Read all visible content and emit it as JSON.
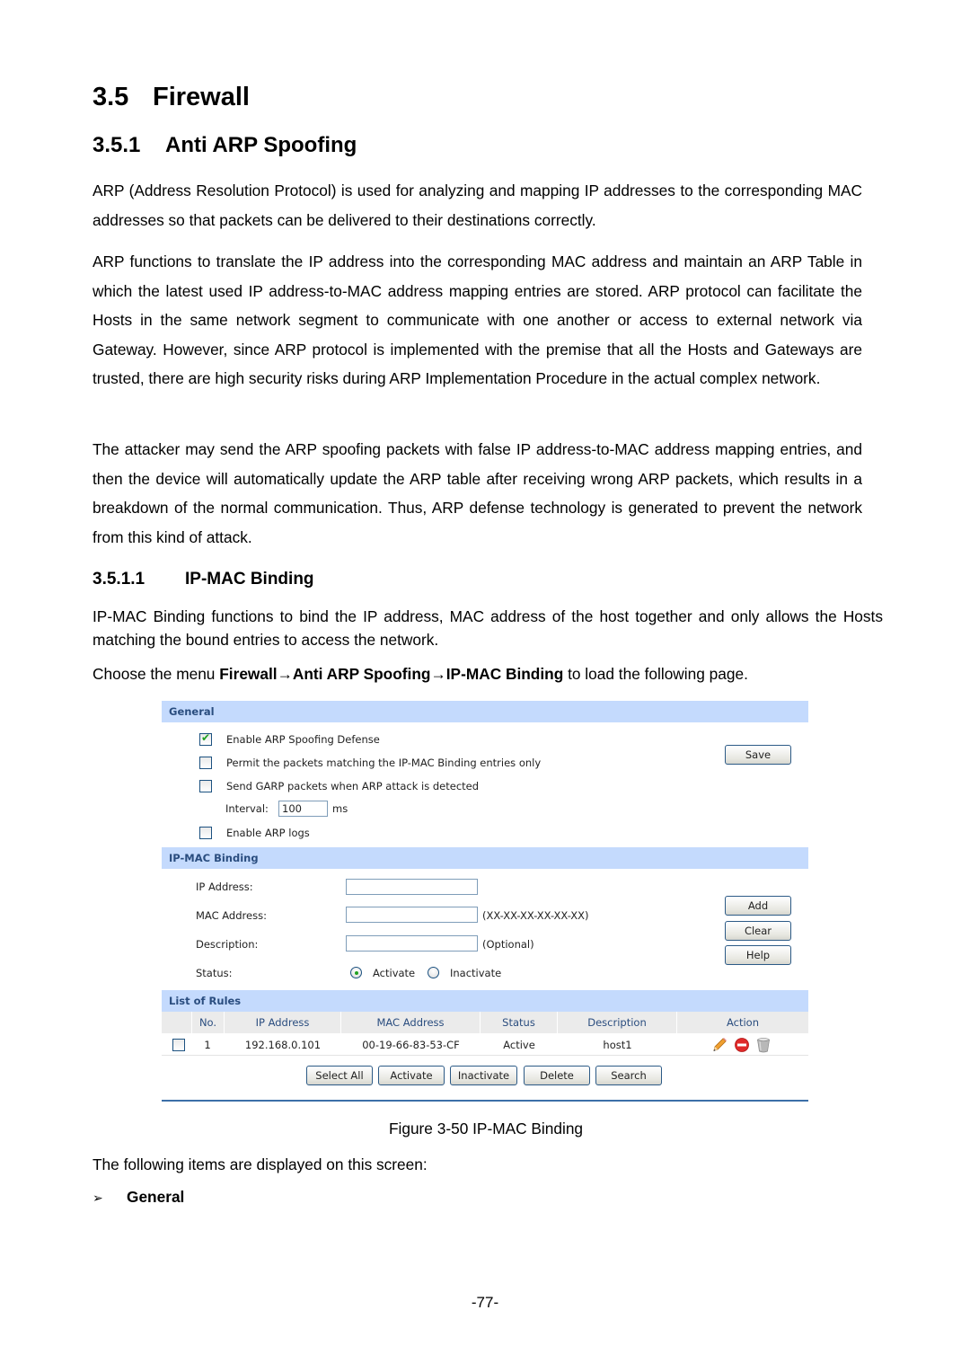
{
  "doc": {
    "h1": {
      "number": "3.5",
      "title": "Firewall"
    },
    "h2": {
      "number": "3.5.1",
      "title": "Anti ARP Spoofing"
    },
    "para1": "ARP (Address Resolution Protocol) is used for analyzing and mapping IP addresses to the corresponding MAC addresses so that packets can be delivered to their destinations correctly.",
    "para2": "ARP functions to translate the IP address into the corresponding MAC address and maintain an ARP Table in which the latest used IP address-to-MAC address mapping entries are stored. ARP protocol can facilitate the Hosts in the same network segment to communicate with one another or access to external network via Gateway. However, since ARP protocol is implemented with the premise that all the Hosts and Gateways are trusted, there are high security risks during ARP Implementation Procedure in the actual complex network.",
    "para3": "The attacker may send the ARP spoofing packets with false IP address-to-MAC address mapping entries, and then the device will automatically update the ARP table after receiving wrong ARP packets, which results in a breakdown of the normal communication. Thus, ARP defense technology is generated to prevent the network from this kind of attack.",
    "h3": {
      "number": "3.5.1.1",
      "title": "IP-MAC Binding"
    },
    "para4": "IP-MAC Binding functions to bind the IP address, MAC address of the host together and only allows the Hosts matching the bound entries to access the network.",
    "para5": {
      "prefix": "Choose the menu ",
      "menu_path": "Firewall→Anti ARP Spoofing→IP-MAC Binding",
      "suffix": " to load the following page."
    },
    "caption": "Figure 3-50 IP-MAC Binding",
    "para6": "The following items are displayed on this screen:",
    "bullet": {
      "icon": "➢",
      "label": "General"
    },
    "page_number": "-77-"
  },
  "ui": {
    "general": {
      "title": "General",
      "options": [
        {
          "label": "Enable ARP Spoofing Defense",
          "checked": true
        },
        {
          "label": "Permit the packets matching the IP-MAC Binding entries only",
          "checked": false
        },
        {
          "label": "Send GARP packets when ARP attack is detected",
          "checked": false
        },
        {
          "label": "Enable ARP logs",
          "checked": false
        }
      ],
      "interval_label": "Interval:",
      "interval_value": "100",
      "interval_unit": "ms",
      "save_label": "Save"
    },
    "ipmac": {
      "title": "IP-MAC Binding",
      "ip_label": "IP Address:",
      "ip_value": "",
      "mac_label": "MAC Address:",
      "mac_value": "",
      "mac_hint": "(XX-XX-XX-XX-XX-XX)",
      "desc_label": "Description:",
      "desc_value": "",
      "desc_hint": "(Optional)",
      "status_label": "Status:",
      "status_options": [
        "Activate",
        "Inactivate"
      ],
      "status_selected": "Activate",
      "add_label": "Add",
      "clear_label": "Clear",
      "help_label": "Help"
    },
    "rules": {
      "title": "List of Rules",
      "columns": [
        "",
        "No.",
        "IP Address",
        "MAC Address",
        "Status",
        "Description",
        "Action"
      ],
      "rows": [
        {
          "checked": false,
          "no": "1",
          "ip": "192.168.0.101",
          "mac": "00-19-66-83-53-CF",
          "status": "Active",
          "description": "host1",
          "actions": [
            "edit-pencil-icon",
            "disable-icon",
            "delete-trash-icon"
          ]
        }
      ],
      "buttons": [
        "Select All",
        "Activate",
        "Inactivate",
        "Delete",
        "Search"
      ]
    },
    "colors": {
      "section_bar": "#c4dafd",
      "section_text": "#2a4d7f",
      "table_header": "#ebebeb",
      "bottom_rule": "#3c6fa8"
    }
  }
}
